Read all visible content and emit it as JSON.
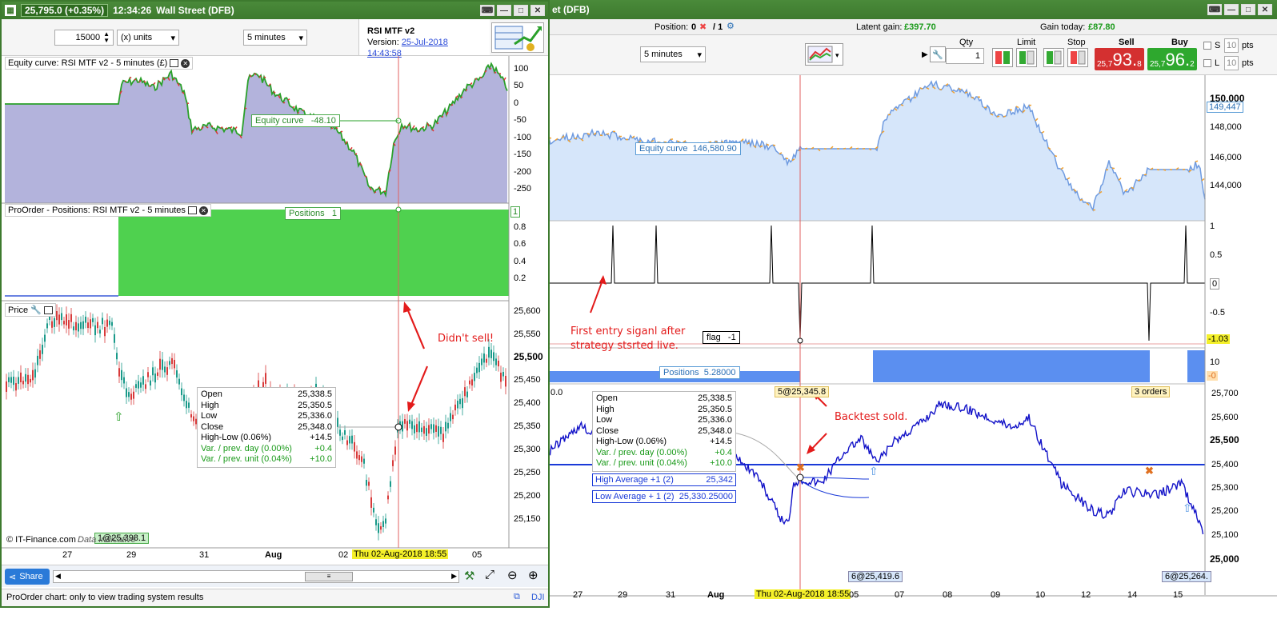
{
  "left_window": {
    "title_change": "25,795.0 (+0.35%)",
    "title_time": "12:34:26",
    "title_instrument": "Wall Street (DFB)",
    "qty_value": "15000",
    "units_label": "(x) units",
    "timeframe": "5 minutes",
    "system_name": "RSI MTF v2",
    "version_label": "Version:",
    "version_date": "25-Jul-2018 14:43:58",
    "equity_panel_title": "Equity curve: RSI MTF v2 - 5 minutes (£)",
    "equity_ticks": [
      "100",
      "50",
      "0",
      "-50",
      "-100",
      "-150",
      "-200",
      "-250"
    ],
    "equity_label": "Equity curve",
    "equity_value": "-48.10",
    "positions_panel_title": "ProOrder - Positions: RSI MTF v2 - 5 minutes",
    "positions_label": "Positions",
    "positions_value": "1",
    "positions_right_val": "1",
    "positions_ticks": [
      "0.8",
      "0.6",
      "0.4",
      "0.2"
    ],
    "price_panel_title": "Price",
    "price_ticks": [
      "25,600",
      "25,550",
      "25,500",
      "25,450",
      "25,400",
      "25,350",
      "25,300",
      "25,250",
      "25,200",
      "25,150"
    ],
    "price_current": "25,500",
    "ohlc": [
      {
        "label": "Open",
        "value": "25,338.5"
      },
      {
        "label": "High",
        "value": "25,350.5"
      },
      {
        "label": "Low",
        "value": "25,336.0"
      },
      {
        "label": "Close",
        "value": "25,348.0"
      },
      {
        "label": "High-Low (0.06%)",
        "value": "+14.5"
      },
      {
        "label": "Var. / prev. day (0.00%)",
        "value": "+0.4",
        "green": true
      },
      {
        "label": "Var. / prev. unit (0.04%)",
        "value": "+10.0",
        "green": true
      }
    ],
    "copyright": "© IT-Finance.com",
    "data_indicative": "Data Indicative",
    "order_badge": "1@25,398.1",
    "x_ticks": [
      "27",
      "29",
      "31",
      "Aug",
      "02",
      "05"
    ],
    "x_highlight": "Thu 02-Aug-2018 18:55",
    "annotation_didnt_sell": "Didn't sell!",
    "share_label": "Share",
    "status_text": "ProOrder chart: only to view trading system results",
    "dji_label": "DJI"
  },
  "right_window": {
    "title_partial": "et (DFB)",
    "position_label": "Position:",
    "position_value": "0",
    "position_total": "/ 1",
    "latent_gain_label": "Latent gain:",
    "latent_gain_value": "£397.70",
    "gain_today_label": "Gain today:",
    "gain_today_value": "£87.80",
    "timeframe": "5 minutes",
    "qty_label": "Qty",
    "qty_value": "1",
    "limit_label": "Limit",
    "stop_label": "Stop",
    "sell_label": "Sell",
    "sell_price_prefix": "25,7",
    "sell_price_big": "93.",
    "sell_price_sup": "8",
    "buy_label": "Buy",
    "buy_price_prefix": "25,7",
    "buy_price_big": "96.",
    "buy_price_sup": "2",
    "s_label": "S",
    "l_label": "L",
    "pts_value": "10",
    "pts_label": "pts",
    "equity_ticks": [
      "150,000",
      "149,447",
      "148,000",
      "146,000",
      "144,000"
    ],
    "equity_label": "Equity curve",
    "equity_value": "146,580.90",
    "flag_ticks": [
      "1",
      "0.5",
      "0",
      "-0.5",
      "-1.03"
    ],
    "flag_label": "flag",
    "flag_value": "-1",
    "positions_ticks": [
      "10",
      "-0"
    ],
    "positions_label": "Positions",
    "positions_value": "5.28000",
    "annotation_first_entry_1": "First entry siganl after",
    "annotation_first_entry_2": "strategy stsrted live.",
    "annotation_backtest": "Backtest sold.",
    "order_badge_top": "5@25,345.8",
    "orders_badge": "3 orders",
    "price_ticks": [
      "25,700",
      "25,600",
      "25,500",
      "25,400",
      "25,300",
      "25,200",
      "25,100",
      "25,000"
    ],
    "left_edge_tick": "0.0",
    "ohlc": [
      {
        "label": "Open",
        "value": "25,338.5"
      },
      {
        "label": "High",
        "value": "25,350.5"
      },
      {
        "label": "Low",
        "value": "25,336.0"
      },
      {
        "label": "Close",
        "value": "25,348.0"
      },
      {
        "label": "High-Low (0.06%)",
        "value": "+14.5"
      },
      {
        "label": "Var. / prev. day (0.00%)",
        "value": "+0.4",
        "green": true
      },
      {
        "label": "Var. / prev. unit (0.04%)",
        "value": "+10.0",
        "green": true
      }
    ],
    "high_avg_label": "High Average +1 (2)",
    "high_avg_value": "25,342",
    "low_avg_label": "Low Average + 1 (2)",
    "low_avg_value": "25,330.25000",
    "bottom_badge_1": "6@25,419.6",
    "bottom_badge_2": "6@25,264.",
    "x_ticks": [
      "27",
      "29",
      "31",
      "Aug",
      "05",
      "07",
      "08",
      "09",
      "10",
      "12",
      "14",
      "15"
    ],
    "x_highlight": "Thu 02-Aug-2018 18:55"
  },
  "colors": {
    "title_green": "#3d7a2e",
    "equity_fill": "#b3b3dc",
    "positions_green": "#4fd14f",
    "candle_green": "#1a9a8a",
    "candle_red": "#d83a3a",
    "right_equity_fill": "#d6e6fa",
    "right_price_line": "#1212c8",
    "sell_red": "#d43030",
    "buy_green": "#2ea82e",
    "annotation_red": "#e31b1b"
  }
}
